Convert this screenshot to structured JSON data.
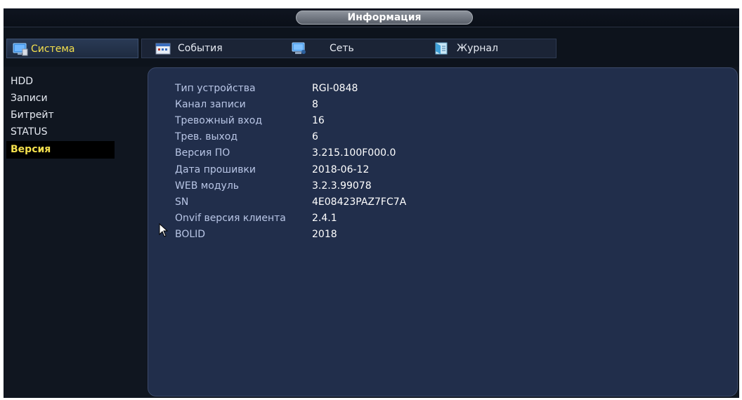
{
  "window": {
    "title": "Информация"
  },
  "tabs": [
    {
      "label": "Система",
      "icon": "monitor-icon",
      "active": true
    },
    {
      "label": "События",
      "icon": "events-icon",
      "active": false
    },
    {
      "label": "Сеть",
      "icon": "network-icon",
      "active": false
    },
    {
      "label": "Журнал",
      "icon": "journal-icon",
      "active": false
    }
  ],
  "sidebar": {
    "items": [
      {
        "label": "HDD",
        "active": false
      },
      {
        "label": "Записи",
        "active": false
      },
      {
        "label": "Битрейт",
        "active": false
      },
      {
        "label": "STATUS",
        "active": false
      },
      {
        "label": "Версия",
        "active": true
      }
    ]
  },
  "info": {
    "rows": [
      {
        "label": "Тип устройства",
        "value": "RGI-0848"
      },
      {
        "label": "Канал записи",
        "value": "8"
      },
      {
        "label": "Тревожный вход",
        "value": "16"
      },
      {
        "label": "Трев. выход",
        "value": "6"
      },
      {
        "label": "Версия ПО",
        "value": "3.215.100F000.0"
      },
      {
        "label": "Дата прошивки",
        "value": "2018-06-12"
      },
      {
        "label": "WEB модуль",
        "value": "3.2.3.99078"
      },
      {
        "label": "SN",
        "value": "4E08423PAZ7FC7A"
      },
      {
        "label": "Onvif версия клиента",
        "value": "2.4.1"
      },
      {
        "label": "BOLID",
        "value": "2018"
      }
    ]
  },
  "colors": {
    "active_text": "#f4e04d",
    "panel_bg": "#212e4b",
    "background": "#101620"
  }
}
